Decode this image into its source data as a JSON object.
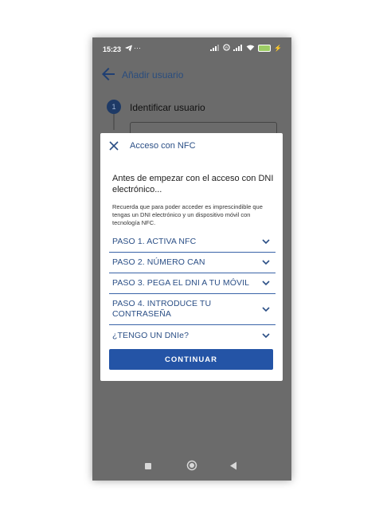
{
  "status_bar": {
    "time": "15:23",
    "dots": "···",
    "battery": "41"
  },
  "appbar": {
    "title": "Añadir usuario"
  },
  "stepper": {
    "step_number": "1",
    "step_label": "Identificar usuario"
  },
  "dialog": {
    "title": "Acceso con NFC",
    "intro_title": "Antes de empezar con el acceso con DNI electrónico...",
    "intro_text": "Recuerda que para poder acceder es imprescindible que tengas un DNI electrónico y un dispositivo móvil con tecnología NFC.",
    "sections": [
      {
        "label": "PASO 1. ACTIVA NFC"
      },
      {
        "label": "PASO 2. NÚMERO CAN"
      },
      {
        "label": "PASO 3. PEGA EL DNI A TU MÓVIL"
      },
      {
        "label": "PASO 4. INTRODUCE TU CONTRASEÑA"
      },
      {
        "label": "¿TENGO UN DNIe?"
      }
    ],
    "continue_label": "CONTINUAR"
  },
  "colors": {
    "accent": "#2454a6",
    "title_blue": "#2b4f86",
    "scrim": "#6b6b6b"
  },
  "icons": [
    "telegram-icon",
    "signal-icon",
    "wifi-icon",
    "battery-icon",
    "back-arrow-icon",
    "close-icon",
    "chevron-down-icon",
    "nav-recents-icon",
    "nav-home-icon",
    "nav-back-icon"
  ]
}
